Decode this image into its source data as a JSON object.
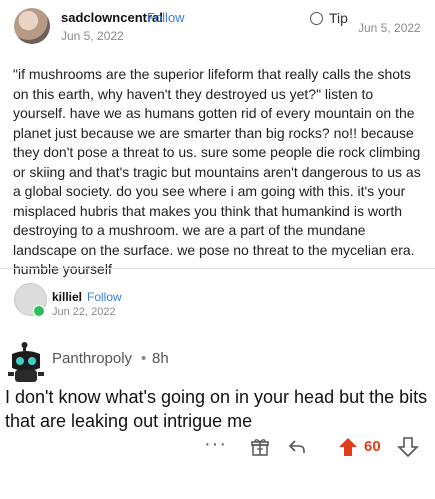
{
  "post": {
    "username": "sadclowncentral",
    "follow_label": "Follow",
    "date": "Jun 5, 2022",
    "tip_label": "Tip",
    "date_right": "Jun 5, 2022",
    "body": "\"if mushrooms are the superior lifeform that really calls the shots on this earth, why haven't they destroyed us yet?\" listen to yourself. have we as humans gotten rid of every mountain on the planet just because we are smarter than big rocks? no!! because they don't pose a threat to us. sure some people die rock climbing or skiing and that's tragic but mountains aren't dangerous to us as a global society. do you see where i am going with this. it's your misplaced hubris that makes you think that humankind is worth destroying to a mushroom. we are a part of the mundane landscape on the surface. we pose no threat to the mycelian era. humble yourself"
  },
  "reblog": {
    "username": "killiel",
    "follow_label": "Follow",
    "date": "Jun 22, 2022"
  },
  "reply": {
    "username": "Panthropoly",
    "separator": "•",
    "time": "8h",
    "body": "I don't know what's going on in your head but the bits that are leaking out intrigue me"
  },
  "actions": {
    "more_label": "···",
    "vote_count": "60",
    "upvote_color": "#e03e1b"
  },
  "icons": [
    "tip-icon",
    "gift-icon",
    "reply-icon",
    "upvote-icon",
    "downvote-icon",
    "more-icon"
  ]
}
